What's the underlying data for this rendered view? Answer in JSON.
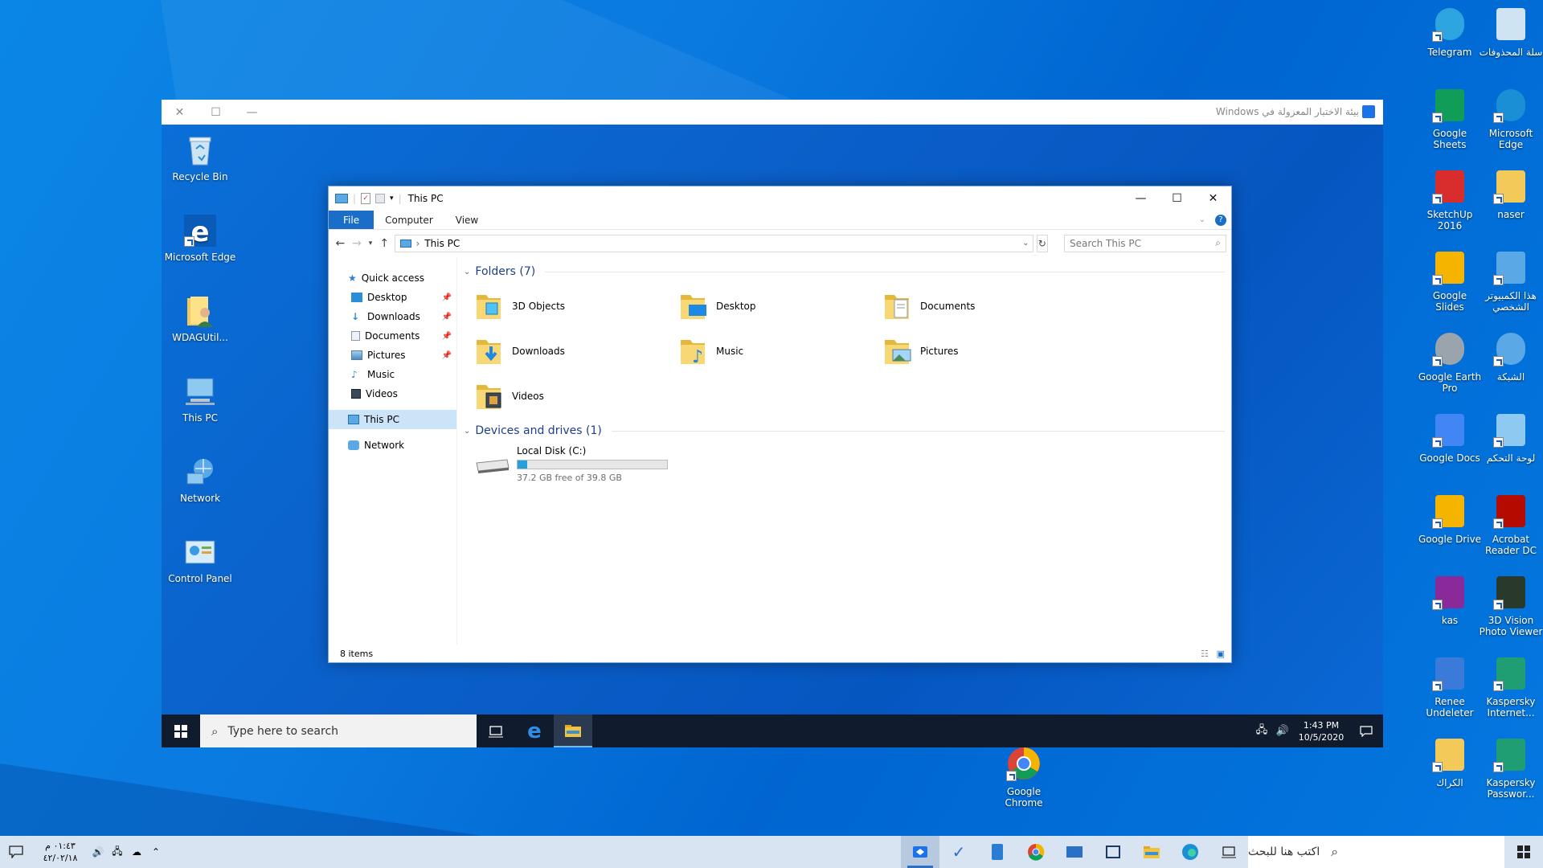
{
  "host_desktop": {
    "icons_right": [
      {
        "label": "Telegram",
        "icon": "telegram-icon"
      },
      {
        "label": "سلة المحذوفات",
        "icon": "recycle-bin-icon"
      },
      {
        "label": "Google Sheets",
        "icon": "google-sheets-icon"
      },
      {
        "label": "Microsoft Edge",
        "icon": "edge-icon"
      },
      {
        "label": "SketchUp 2016",
        "icon": "sketchup-icon"
      },
      {
        "label": "naser",
        "icon": "user-folder-icon"
      },
      {
        "label": "Google Slides",
        "icon": "google-slides-icon"
      },
      {
        "label": "هذا الكمبيوتر الشخصي",
        "icon": "this-pc-icon"
      },
      {
        "label": "Google Earth Pro",
        "icon": "google-earth-icon"
      },
      {
        "label": "الشبكة",
        "icon": "network-icon"
      },
      {
        "label": "Google Docs",
        "icon": "google-docs-icon"
      },
      {
        "label": "لوحة التحكم",
        "icon": "control-panel-icon"
      },
      {
        "label": "Google Drive",
        "icon": "google-drive-icon"
      },
      {
        "label": "Acrobat Reader DC",
        "icon": "acrobat-icon"
      },
      {
        "label": "kas",
        "icon": "winrar-icon"
      },
      {
        "label": "3D Vision Photo Viewer",
        "icon": "3d-vision-icon"
      },
      {
        "label": "Renee Undeleter",
        "icon": "renee-icon"
      },
      {
        "label": "Kaspersky Internet...",
        "icon": "kaspersky-icon"
      },
      {
        "label": "الكراك",
        "icon": "folder-icon"
      },
      {
        "label": "Kaspersky Passwor...",
        "icon": "kaspersky-password-icon"
      }
    ],
    "chrome_label": "Google Chrome"
  },
  "sandbox": {
    "title": "بيئة الاختبار المعزولة في Windows",
    "guest_icons": [
      {
        "label": "Recycle Bin",
        "icon": "recycle-bin-icon"
      },
      {
        "label": "Microsoft Edge",
        "icon": "edge-icon"
      },
      {
        "label": "WDAGUtil...",
        "icon": "user-folder-icon"
      },
      {
        "label": "This PC",
        "icon": "this-pc-icon"
      },
      {
        "label": "Network",
        "icon": "network-icon"
      },
      {
        "label": "Control Panel",
        "icon": "control-panel-icon"
      }
    ],
    "taskbar": {
      "search_placeholder": "Type here to search",
      "time": "1:43 PM",
      "date": "10/5/2020"
    }
  },
  "explorer": {
    "title": "This PC",
    "ribbon_tabs": [
      "File",
      "Computer",
      "View"
    ],
    "address": "This PC",
    "search_placeholder": "Search This PC",
    "nav": {
      "quick_access": "Quick access",
      "quick_items": [
        "Desktop",
        "Downloads",
        "Documents",
        "Pictures",
        "Music",
        "Videos"
      ],
      "this_pc": "This PC",
      "network": "Network"
    },
    "folders_header": "Folders (7)",
    "folders": [
      "3D Objects",
      "Desktop",
      "Documents",
      "Downloads",
      "Music",
      "Pictures",
      "Videos"
    ],
    "devices_header": "Devices and drives (1)",
    "drive": {
      "name": "Local Disk (C:)",
      "free_text": "37.2 GB free of 39.8 GB",
      "used_fraction": 0.065
    },
    "status": "8 items"
  },
  "host_taskbar": {
    "search_placeholder": "اكتب هنا للبحث",
    "time": "٠١:٤٣ م",
    "date": "٤٢/٠٢/١٨"
  },
  "colors": {
    "accent": "#1a6ec7",
    "drive_bar": "#26a0da",
    "host_taskbar": "#d8e4f1",
    "guest_taskbar": "#101c2e"
  }
}
